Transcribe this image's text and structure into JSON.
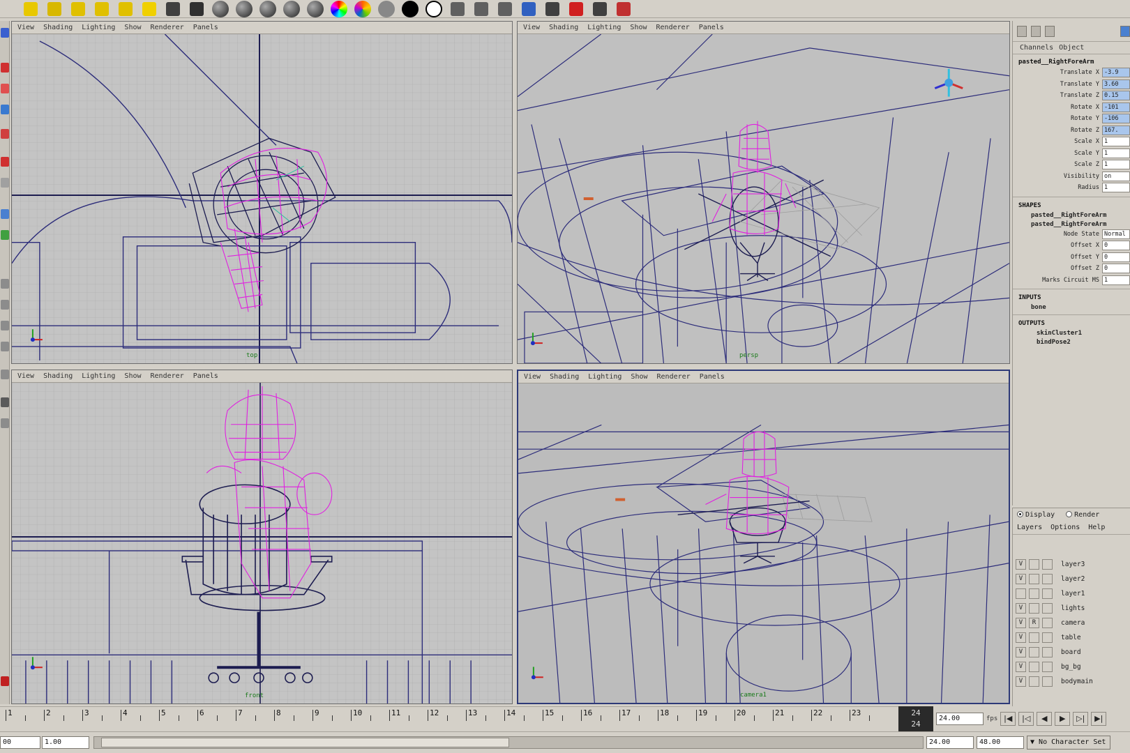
{
  "shelf": {
    "icons": [
      "light-icon",
      "magnify-icon",
      "grid-icon",
      "spark-icon",
      "sun-icon",
      "bulb-icon",
      "camera-icon",
      "render-icon",
      "sphere-icon",
      "sphere-icon",
      "sphere-icon",
      "sphere-icon",
      "sphere-icon",
      "rainbow-sphere-icon",
      "color-wheel-icon",
      "gray-sphere-icon",
      "black-sphere-icon",
      "white-ring-icon",
      "window-icon",
      "window-icon",
      "window-icon",
      "globe-icon",
      "tool-icon",
      "x-tool-icon",
      "bar-icon",
      "paint-icon"
    ]
  },
  "viewport_menu": [
    "View",
    "Shading",
    "Lighting",
    "Show",
    "Renderer",
    "Panels"
  ],
  "viewports": {
    "top": {
      "label": "top"
    },
    "persp": {
      "label": "persp"
    },
    "front": {
      "label": "front"
    },
    "camera": {
      "label": "camera1"
    }
  },
  "channel_box": {
    "tabs": [
      "Channels",
      "Object"
    ],
    "object_name": "pasted__RightForeArm",
    "attributes": [
      {
        "label": "Translate X",
        "value": "-3.9",
        "highlight": true
      },
      {
        "label": "Translate Y",
        "value": "3.60",
        "highlight": true
      },
      {
        "label": "Translate Z",
        "value": "0.15",
        "highlight": true
      },
      {
        "label": "Rotate X",
        "value": "-101",
        "highlight": true
      },
      {
        "label": "Rotate Y",
        "value": "-106",
        "highlight": true
      },
      {
        "label": "Rotate Z",
        "value": "167.",
        "highlight": true
      },
      {
        "label": "Scale X",
        "value": "1",
        "highlight": false
      },
      {
        "label": "Scale Y",
        "value": "1",
        "highlight": false
      },
      {
        "label": "Scale Z",
        "value": "1",
        "highlight": false
      },
      {
        "label": "Visibility",
        "value": "on",
        "highlight": false
      },
      {
        "label": "Radius",
        "value": "1",
        "highlight": false
      }
    ],
    "shapes_header": "SHAPES",
    "shapes": [
      "pasted__RightForeArm",
      "pasted__RightForeArm"
    ],
    "shape_attributes": [
      {
        "label": "Node State",
        "value": "Normal"
      },
      {
        "label": "Offset X",
        "value": "0"
      },
      {
        "label": "Offset Y",
        "value": "0"
      },
      {
        "label": "Offset Z",
        "value": "0"
      },
      {
        "label": "Marks Circuit MS",
        "value": "1"
      }
    ],
    "inputs_header": "INPUTS",
    "inputs": [
      "bone"
    ],
    "outputs_header": "OUTPUTS",
    "outputs": [
      "skinCluster1",
      "bindPose2"
    ]
  },
  "layer_editor": {
    "mode_display": "Display",
    "mode_render": "Render",
    "menu": [
      "Layers",
      "Options",
      "Help"
    ],
    "layers": [
      {
        "v": "V",
        "t": "",
        "name": "layer3"
      },
      {
        "v": "V",
        "t": "",
        "name": "layer2"
      },
      {
        "v": "",
        "t": "",
        "name": "layer1"
      },
      {
        "v": "V",
        "t": "",
        "name": "lights"
      },
      {
        "v": "V",
        "t": "R",
        "name": "camera"
      },
      {
        "v": "V",
        "t": "",
        "name": "table"
      },
      {
        "v": "V",
        "t": "",
        "name": "board"
      },
      {
        "v": "V",
        "t": "",
        "name": "bg_bg"
      },
      {
        "v": "V",
        "t": "",
        "name": "bodymain"
      }
    ]
  },
  "timeline": {
    "numbers": [
      "1",
      "2",
      "3",
      "4",
      "5",
      "6",
      "7",
      "8",
      "9",
      "10",
      "11",
      "12",
      "13",
      "14",
      "15",
      "16",
      "17",
      "18",
      "19",
      "20",
      "21",
      "22",
      "23"
    ],
    "current_frame_top": "24",
    "current_frame_bottom": "24",
    "current_time_field": "24.00",
    "fps_label": "fps"
  },
  "range": {
    "left_stub": "00",
    "start_field": "1.00",
    "end_field": "24.00",
    "max_field": "48.00",
    "character_set": "No Character Set"
  }
}
